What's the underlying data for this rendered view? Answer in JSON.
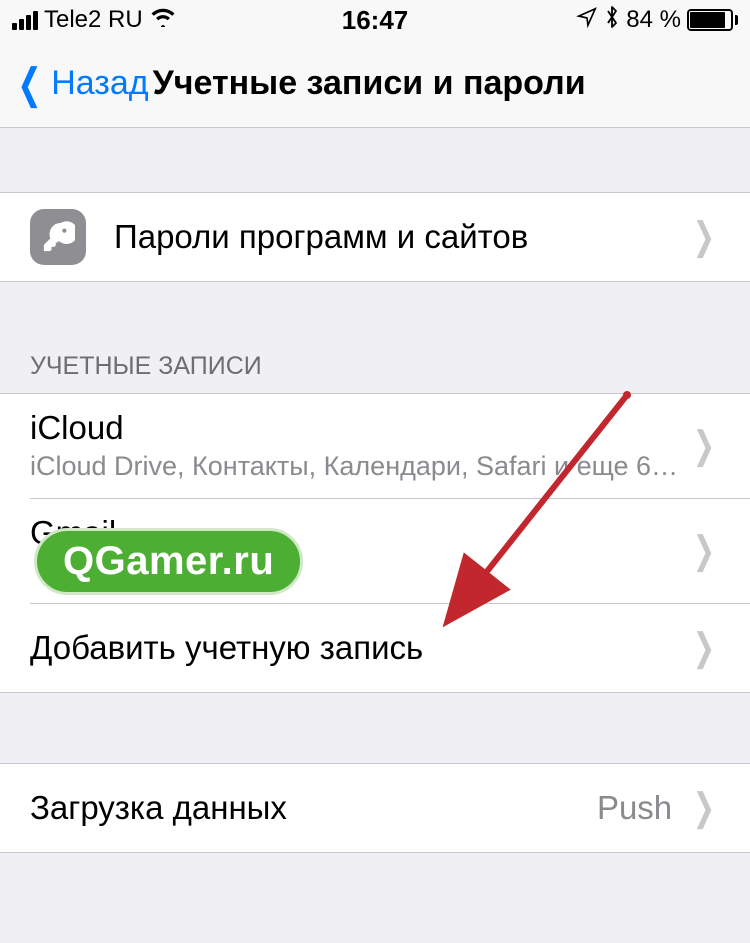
{
  "status_bar": {
    "carrier": "Tele2 RU",
    "time": "16:47",
    "battery_pct": "84 %"
  },
  "nav": {
    "back_label": "Назад",
    "title": "Учетные записи и пароли"
  },
  "passwords_row": {
    "label": "Пароли программ и сайтов"
  },
  "accounts_section": {
    "header": "УЧЕТНЫЕ ЗАПИСИ",
    "icloud": {
      "title": "iCloud",
      "subtitle": "iCloud Drive, Контакты, Календари, Safari и еще 6…"
    },
    "gmail": {
      "title": "Gmail"
    },
    "add_account": {
      "label": "Добавить учетную запись"
    }
  },
  "fetch_section": {
    "label": "Загрузка данных",
    "value": "Push"
  },
  "watermark": {
    "text": "QGamer.ru"
  }
}
